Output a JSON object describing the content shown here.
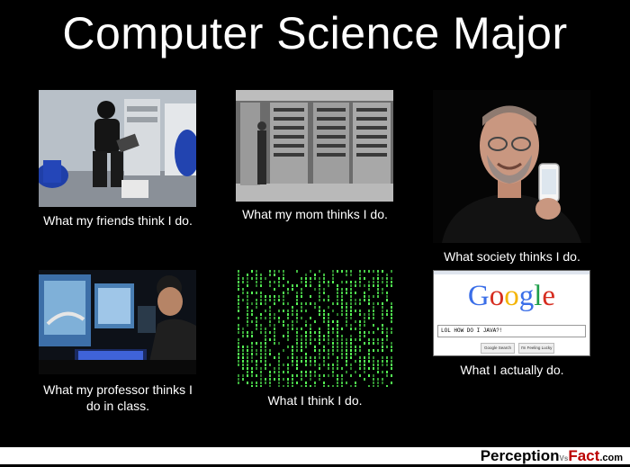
{
  "title": "Computer Science Major",
  "panels": [
    {
      "caption": "What my friends think I do."
    },
    {
      "caption": "What my mom thinks I do."
    },
    {
      "caption": "What society thinks I do."
    },
    {
      "caption_line1": "What my professor thinks I",
      "caption_line2": "do in class."
    },
    {
      "caption": "What I think I do."
    },
    {
      "caption": "What I actually do."
    }
  ],
  "google": {
    "logo_letters": [
      "G",
      "o",
      "o",
      "g",
      "l",
      "e"
    ],
    "logo_colors": [
      "#3a6ee8",
      "#d62d20",
      "#f4b400",
      "#3a6ee8",
      "#1e9e4a",
      "#d62d20"
    ],
    "query": "LOL HOW DO I JAVA?!",
    "search_button": "Google Search",
    "lucky_button": "I'm Feeling Lucky"
  },
  "footer": {
    "brand_left": "Perception",
    "brand_vs": "Vs",
    "brand_right": "Fact",
    "brand_domain": ".com"
  }
}
